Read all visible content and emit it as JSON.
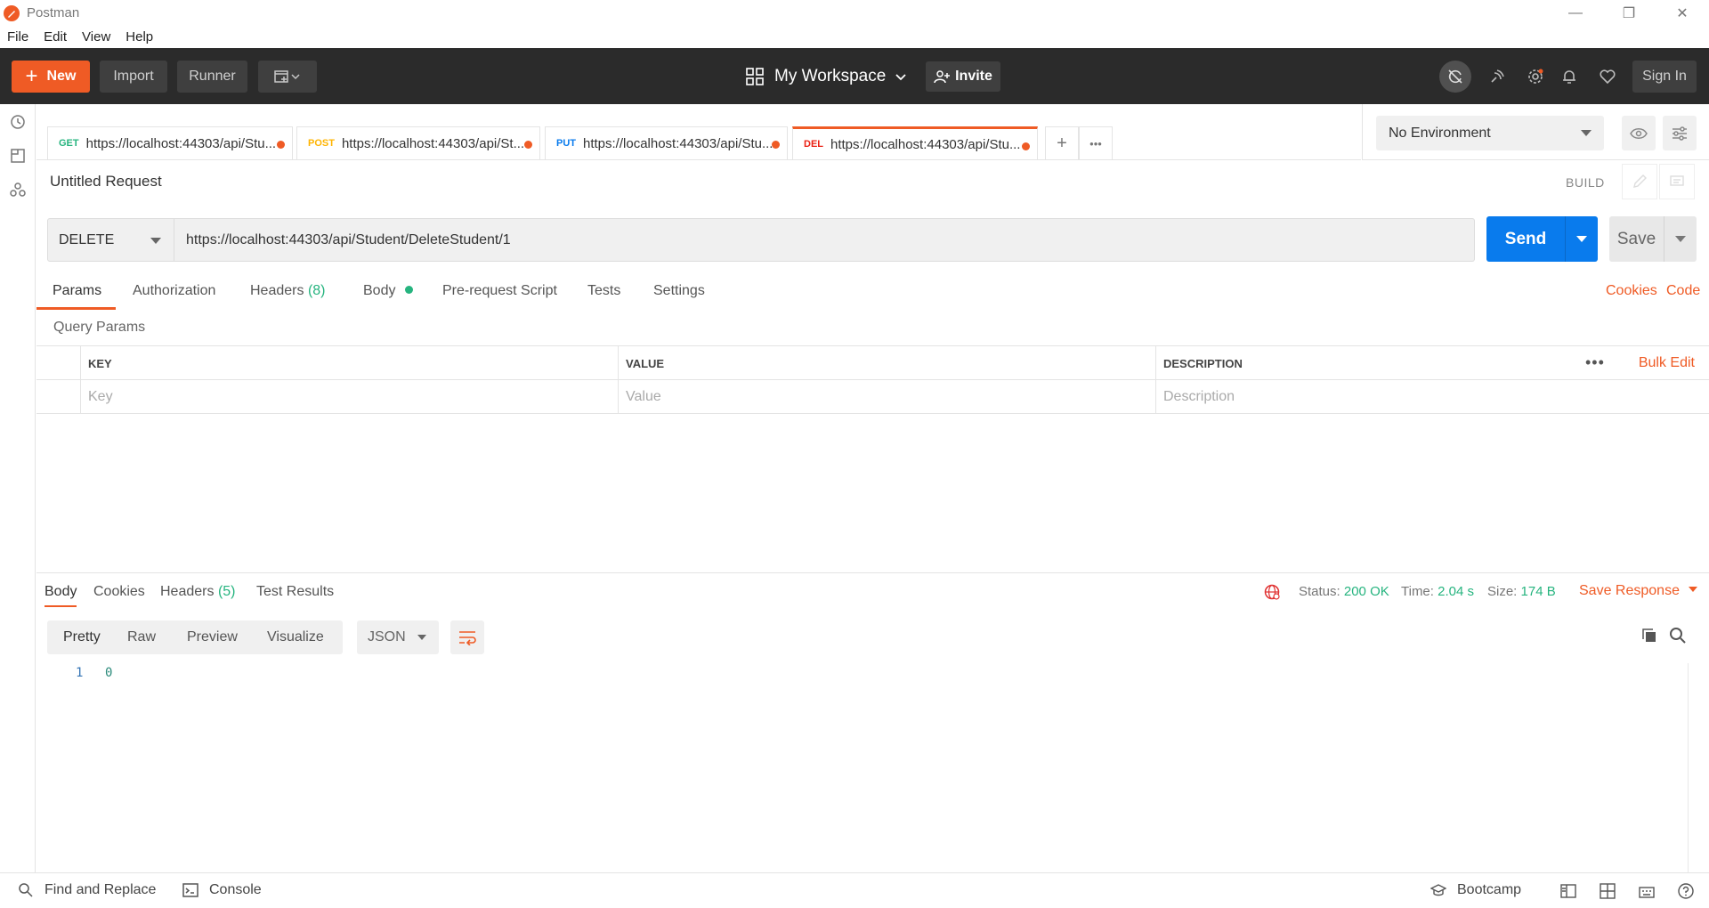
{
  "window": {
    "title": "Postman",
    "minimize": "—",
    "maximize": "❐",
    "close": "✕"
  },
  "menu": [
    "File",
    "Edit",
    "View",
    "Help"
  ],
  "header": {
    "new_label": "New",
    "import_label": "Import",
    "runner_label": "Runner",
    "workspace_label": "My Workspace",
    "invite_label": "Invite",
    "signin_label": "Sign In"
  },
  "tabs": [
    {
      "method": "GET",
      "method_color": "#26b47f",
      "url": "https://localhost:44303/api/Stu..."
    },
    {
      "method": "POST",
      "method_color": "#ffb400",
      "url": "https://localhost:44303/api/St..."
    },
    {
      "method": "PUT",
      "method_color": "#097bed",
      "url": "https://localhost:44303/api/Stu..."
    },
    {
      "method": "DEL",
      "method_color": "#eb2013",
      "url": "https://localhost:44303/api/Stu..."
    }
  ],
  "environment": {
    "selected": "No Environment"
  },
  "request": {
    "title": "Untitled Request",
    "build_label": "BUILD",
    "method": "DELETE",
    "url": "https://localhost:44303/api/Student/DeleteStudent/1",
    "send_label": "Send",
    "save_label": "Save"
  },
  "request_tabs": {
    "params": "Params",
    "authorization": "Authorization",
    "headers": "Headers",
    "headers_count": "(8)",
    "body": "Body",
    "prerequest": "Pre-request Script",
    "tests": "Tests",
    "settings": "Settings",
    "cookies_link": "Cookies",
    "code_link": "Code"
  },
  "params": {
    "section_label": "Query Params",
    "columns": [
      "KEY",
      "VALUE",
      "DESCRIPTION"
    ],
    "placeholders": [
      "Key",
      "Value",
      "Description"
    ],
    "bulk_edit": "Bulk Edit",
    "more": "•••"
  },
  "response": {
    "tabs": {
      "body": "Body",
      "cookies": "Cookies",
      "headers": "Headers",
      "headers_count": "(5)",
      "tests": "Test Results"
    },
    "status_label": "Status:",
    "status_value": "200 OK",
    "time_label": "Time:",
    "time_value": "2.04 s",
    "size_label": "Size:",
    "size_value": "174 B",
    "save_response": "Save Response",
    "formats": [
      "Pretty",
      "Raw",
      "Preview",
      "Visualize"
    ],
    "language": "JSON",
    "code_line_number": "1",
    "code_value": "0"
  },
  "statusbar": {
    "find_replace": "Find and Replace",
    "console": "Console",
    "bootcamp": "Bootcamp"
  },
  "colors": {
    "accent": "#ef5b25",
    "send_blue": "#097bed",
    "success_green": "#26b47f",
    "header_bg": "#2b2b2b"
  }
}
